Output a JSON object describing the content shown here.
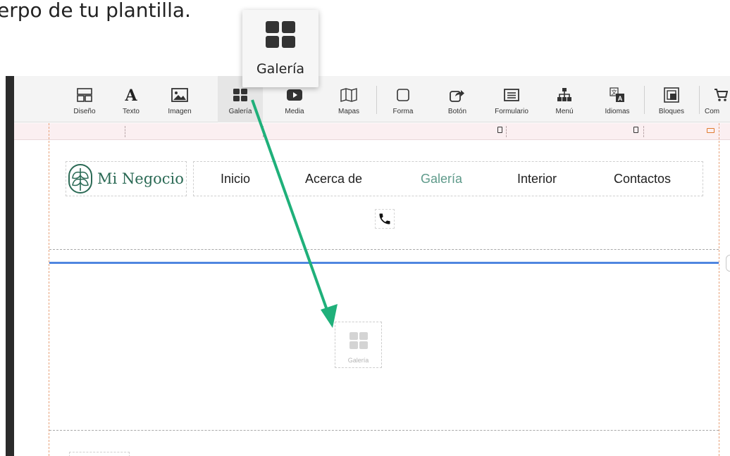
{
  "caption": {
    "text": "erpo de tu plantilla."
  },
  "toolbar": {
    "items": [
      {
        "label": "Diseño",
        "icon": "layout-icon"
      },
      {
        "label": "Texto",
        "icon": "text-icon"
      },
      {
        "label": "Imagen",
        "icon": "image-icon"
      },
      {
        "label": "Galería",
        "icon": "gallery-icon",
        "active": true
      },
      {
        "label": "Media",
        "icon": "play-icon"
      },
      {
        "label": "Mapas",
        "icon": "map-icon"
      },
      {
        "label": "Forma",
        "icon": "shape-icon"
      },
      {
        "label": "Botón",
        "icon": "share-arrow-icon"
      },
      {
        "label": "Formulario",
        "icon": "form-icon"
      },
      {
        "label": "Menú",
        "icon": "sitemap-icon"
      },
      {
        "label": "Idiomas",
        "icon": "translate-icon"
      },
      {
        "label": "Bloques",
        "icon": "blocks-icon"
      },
      {
        "label": "Com",
        "icon": "cart-icon"
      }
    ]
  },
  "tooltip": {
    "label": "Galería",
    "icon": "gallery-icon"
  },
  "site": {
    "logo_text": "Mi Negocio",
    "nav": [
      {
        "label": "Inicio"
      },
      {
        "label": "Acerca de"
      },
      {
        "label": "Galería",
        "current": true
      },
      {
        "label": "Interior"
      },
      {
        "label": "Contactos"
      }
    ]
  },
  "drop_placeholder": {
    "label": "Galería"
  },
  "colors": {
    "accent_arrow": "#1fb07a",
    "brand_green": "#2b6a55",
    "nav_current": "#5e9a8a",
    "insert_line": "#4f86e0"
  }
}
